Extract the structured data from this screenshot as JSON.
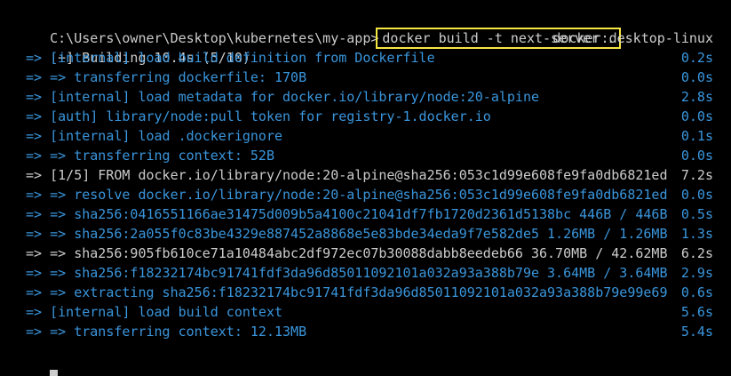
{
  "prompt": {
    "path": "C:\\Users\\owner\\Desktop\\kubernetes\\my-app>",
    "command": "docker build -t next-server ."
  },
  "status": {
    "left": "[+] Building 10.4s (5/10)",
    "right": "docker:desktop-linux"
  },
  "steps": [
    {
      "text": " => [internal] load build definition from Dockerfile",
      "time": "0.2s",
      "color": "blue"
    },
    {
      "text": " => => transferring dockerfile: 170B",
      "time": "0.0s",
      "color": "blue"
    },
    {
      "text": " => [internal] load metadata for docker.io/library/node:20-alpine",
      "time": "2.8s",
      "color": "blue"
    },
    {
      "text": " => [auth] library/node:pull token for registry-1.docker.io",
      "time": "0.0s",
      "color": "blue"
    },
    {
      "text": " => [internal] load .dockerignore",
      "time": "0.1s",
      "color": "blue"
    },
    {
      "text": " => => transferring context: 52B",
      "time": "0.0s",
      "color": "blue"
    },
    {
      "text": " => [1/5] FROM docker.io/library/node:20-alpine@sha256:053c1d99e608fe9fa0db6821ed",
      "time": "7.2s",
      "color": "white"
    },
    {
      "text": " => => resolve docker.io/library/node:20-alpine@sha256:053c1d99e608fe9fa0db6821ed",
      "time": "0.0s",
      "color": "blue"
    },
    {
      "text": " => => sha256:0416551166ae31475d009b5a4100c21041df7fb1720d2361d5138bc 446B / 446B",
      "time": "0.5s",
      "color": "blue"
    },
    {
      "text": " => => sha256:2a055f0c83be4329e887452a8868e5e83bde34eda9f7e582de5 1.26MB / 1.26MB",
      "time": "1.3s",
      "color": "blue"
    },
    {
      "text": " => => sha256:905fb610ce71a10484abc2df972ec07b30088dabb8eedeb66 36.70MB / 42.62MB",
      "time": "6.2s",
      "color": "white"
    },
    {
      "text": " => => sha256:f18232174bc91741fdf3da96d85011092101a032a93a388b79e 3.64MB / 3.64MB",
      "time": "2.9s",
      "color": "blue"
    },
    {
      "text": " => => extracting sha256:f18232174bc91741fdf3da96d85011092101a032a93a388b79e99e69",
      "time": "0.6s",
      "color": "blue"
    },
    {
      "text": " => [internal] load build context",
      "time": "5.6s",
      "color": "blue"
    },
    {
      "text": " => => transferring context: 12.13MB",
      "time": "5.4s",
      "color": "blue"
    }
  ],
  "colors": {
    "background": "#000000",
    "text": "#cccccc",
    "step_blue": "#3a96dd",
    "highlight_border": "#f5e642"
  }
}
